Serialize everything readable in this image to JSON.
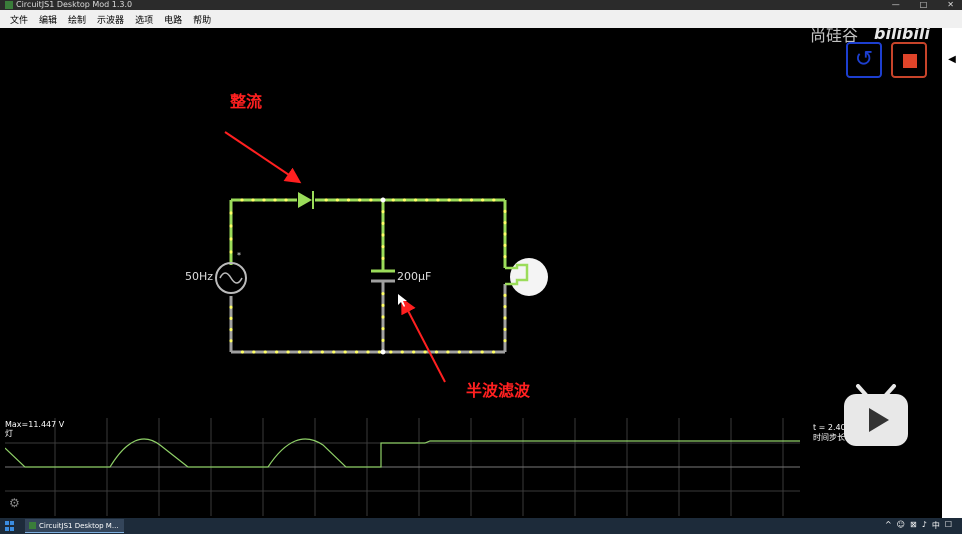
{
  "window": {
    "title": "CircuitJS1 Desktop Mod 1.3.0",
    "minimize": "—",
    "maximize": "□",
    "close": "✕"
  },
  "menu": [
    "文件",
    "编辑",
    "绘制",
    "示波器",
    "选项",
    "电路",
    "帮助"
  ],
  "watermark": {
    "site": "尚硅谷",
    "logo": "bilibili"
  },
  "controls": {
    "reset_icon": "↺",
    "stop_icon": "stop-square",
    "collapse_icon": "◀"
  },
  "circuit": {
    "source_label": "50Hz",
    "source_marker": "*",
    "capacitor_label": "200µF"
  },
  "annotations": {
    "rectify": "整流",
    "filter": "半波滤波"
  },
  "scope": {
    "max_label": "Max=11.447 V",
    "channel_label": "灯",
    "time_label": "t = 2.40? s",
    "step_label": "时间步长 = 5 µs"
  },
  "taskbar": {
    "task_label": "CircuitJS1 Desktop M..."
  },
  "colors": {
    "wire_active": "#9bdc5a",
    "current_dot": "#ffff66",
    "wire_idle": "#a0a0a0",
    "annotation": "#ff2020",
    "scope_trace": "#8fd068"
  }
}
